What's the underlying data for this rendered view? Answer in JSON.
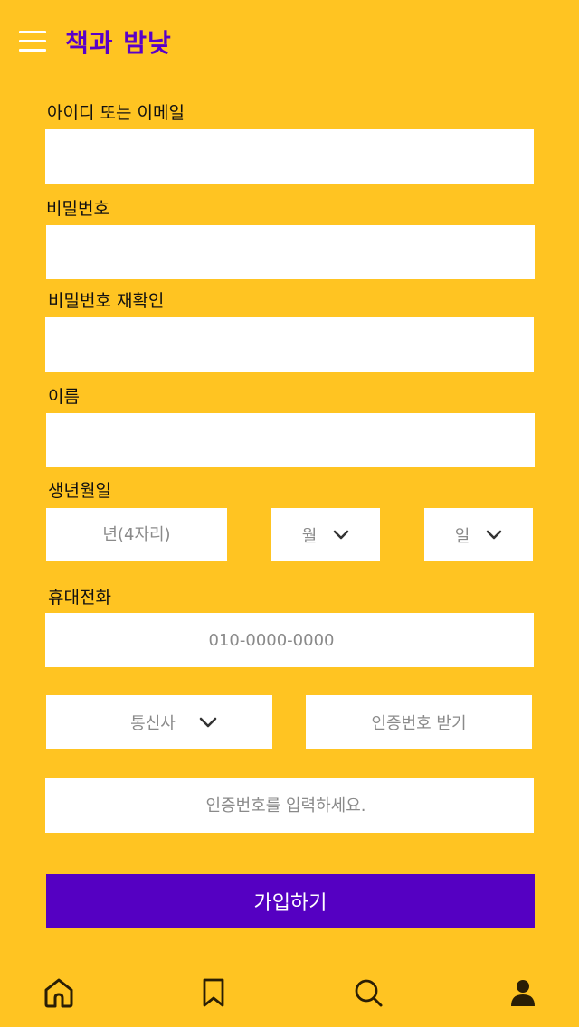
{
  "header": {
    "title": "책과 밤낮",
    "menu_icon": "hamburger-menu-icon"
  },
  "form": {
    "id_label": "아이디 또는 이메일",
    "password_label": "비밀번호",
    "password_confirm_label": "비밀번호 재확인",
    "name_label": "이름",
    "birth_label": "생년월일",
    "birth_year_placeholder": "년(4자리)",
    "birth_month_label": "월",
    "birth_day_label": "일",
    "phone_label": "휴대전화",
    "phone_placeholder": "010-0000-0000",
    "carrier_label": "통신사",
    "get_code_label": "인증번호 받기",
    "code_placeholder": "인증번호를 입력하세요.",
    "submit_label": "가입하기"
  },
  "tabbar": {
    "items": [
      "home-icon",
      "bookmark-icon",
      "search-icon",
      "user-icon"
    ]
  },
  "colors": {
    "background": "#FFC422",
    "accent": "#5500C2",
    "brand": "#5A00C8"
  }
}
